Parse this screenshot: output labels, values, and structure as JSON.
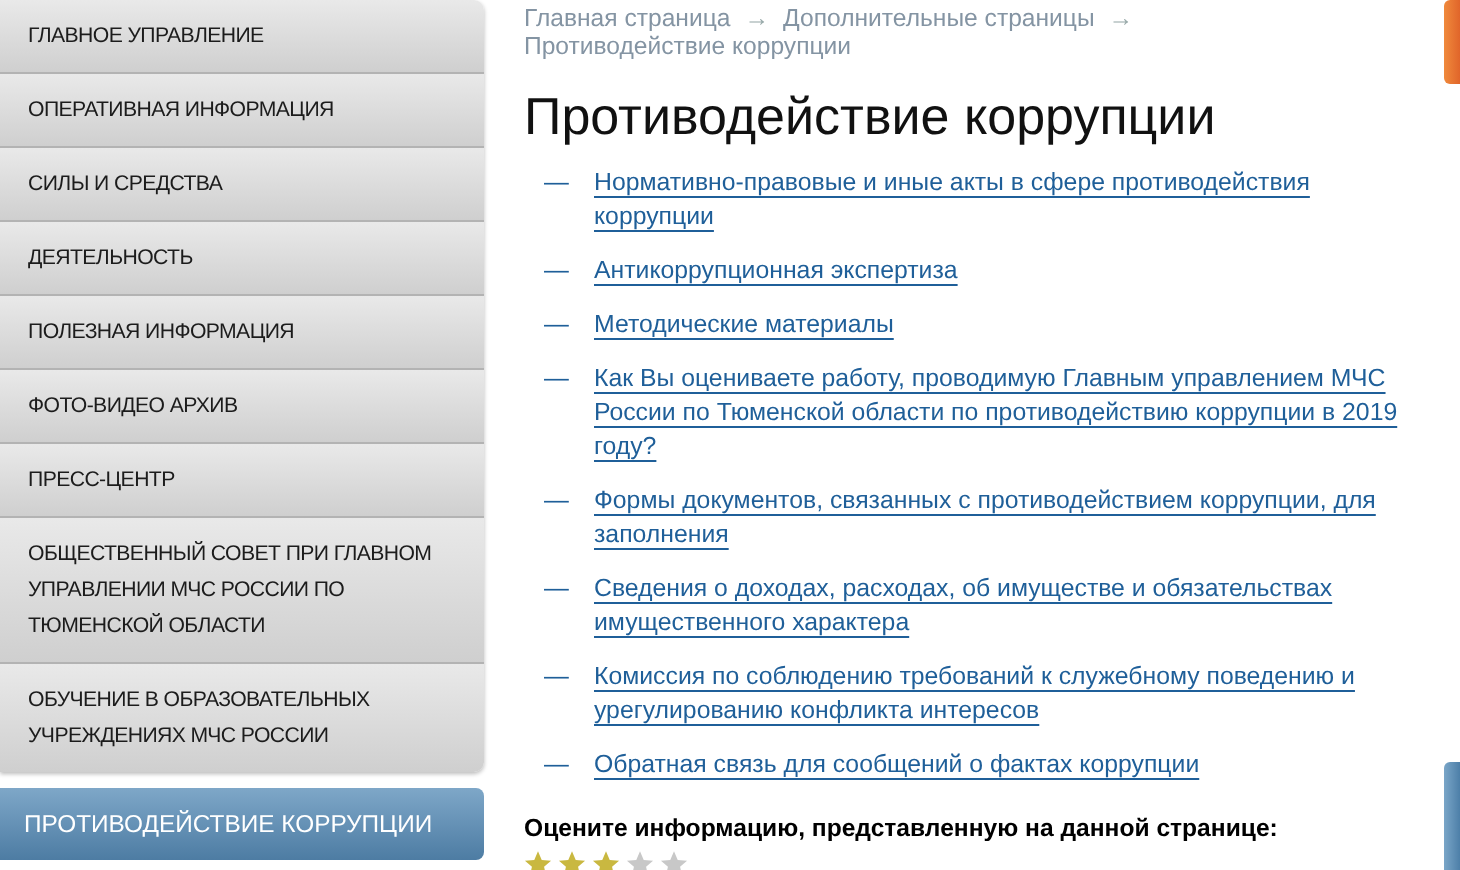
{
  "sidebar": {
    "items": [
      {
        "label": "ГЛАВНОЕ УПРАВЛЕНИЕ",
        "selected": false
      },
      {
        "label": "ОПЕРАТИВНАЯ ИНФОРМАЦИЯ",
        "selected": false
      },
      {
        "label": "СИЛЫ И СРЕДСТВА",
        "selected": false
      },
      {
        "label": "ДЕЯТЕЛЬНОСТЬ",
        "selected": false
      },
      {
        "label": "ПОЛЕЗНАЯ ИНФОРМАЦИЯ",
        "selected": false
      },
      {
        "label": "ФОТО-ВИДЕО АРХИВ",
        "selected": false
      },
      {
        "label": "ПРЕСС-ЦЕНТР",
        "selected": false
      },
      {
        "label": "ОБЩЕСТВЕННЫЙ СОВЕТ ПРИ ГЛАВНОМ УПРАВЛЕНИИ МЧС РОССИИ ПО ТЮМЕНСКОЙ ОБЛАСТИ",
        "selected": false
      },
      {
        "label": "ОБУЧЕНИЕ В ОБРАЗОВАТЕЛЬНЫХ УЧРЕЖДЕНИЯХ МЧС РОССИИ",
        "selected": false
      },
      {
        "label": "ПРОТИВОДЕЙСТВИЕ КОРРУПЦИИ",
        "selected": true
      }
    ]
  },
  "breadcrumb": [
    {
      "kind": "link",
      "text": "Главная страница"
    },
    {
      "kind": "separator",
      "text": "→"
    },
    {
      "kind": "link",
      "text": "Дополнительные страницы"
    },
    {
      "kind": "separator",
      "text": "→"
    },
    {
      "kind": "current",
      "text": "Противодействие коррупции"
    }
  ],
  "page_title": "Противодействие коррупции",
  "links": [
    {
      "marker": "—",
      "text": "Нормативно-правовые и иные акты в сфере противодействия коррупции"
    },
    {
      "marker": "—",
      "text": "Антикоррупционная экспертиза"
    },
    {
      "marker": "—",
      "text": "Методические материалы"
    },
    {
      "marker": "—",
      "text": "Как Вы оцениваете работу, проводимую Главным управлением МЧС России по Тюменской области по противодействию коррупции в 2019 году?"
    },
    {
      "marker": "—",
      "text": "Формы документов, связанных с противодействием коррупции, для заполнения"
    },
    {
      "marker": "—",
      "text": "Сведения о доходах, расходах, об имуществе и обязательствах имущественного характера"
    },
    {
      "marker": "—",
      "text": "Комиссия по соблюдению требований к служебному поведению и урегулированию конфликта интересов"
    },
    {
      "marker": "—",
      "text": "Обратная связь для сообщений о фактах коррупции"
    }
  ],
  "rating": {
    "prompt": "Оцените информацию, представленную на данной странице:",
    "stars": 3
  }
}
